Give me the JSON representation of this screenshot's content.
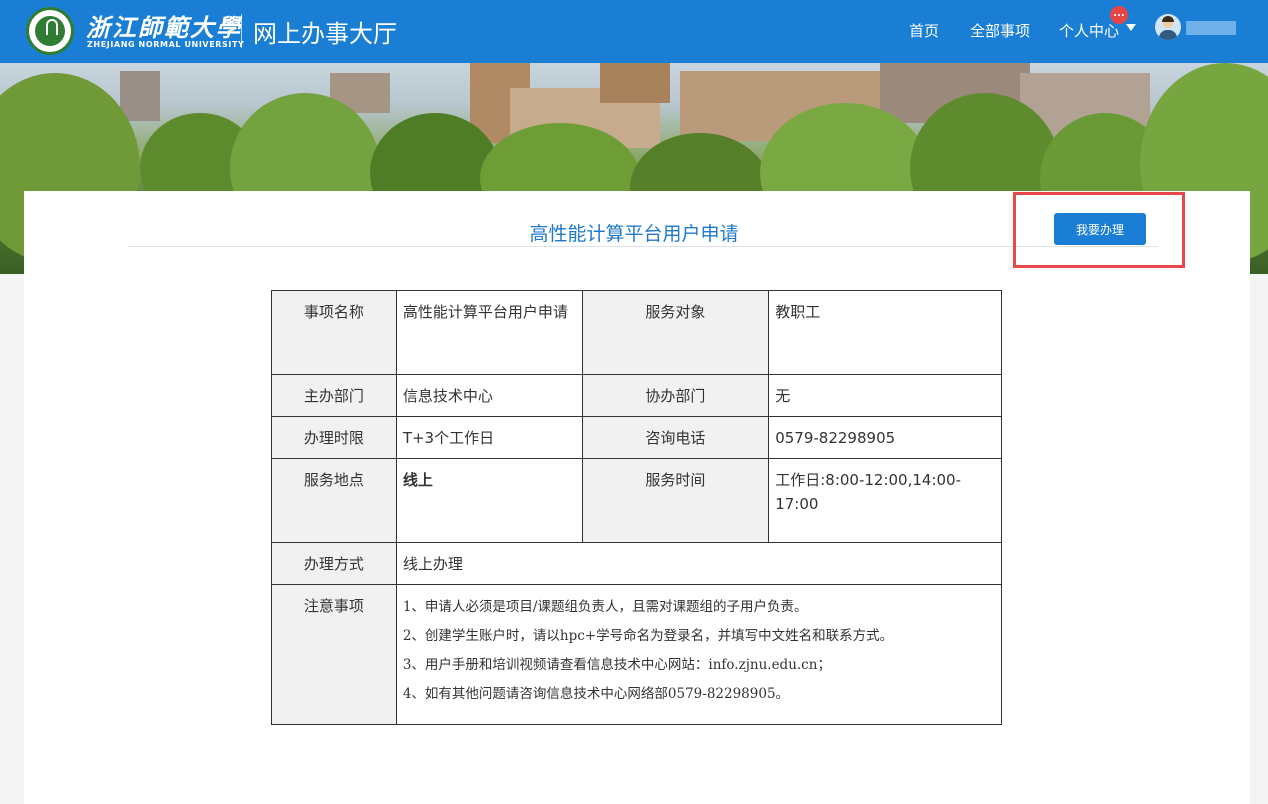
{
  "header": {
    "logo_text_cn": "浙江師範大學",
    "logo_text_en": "ZHEJIANG NORMAL UNIVERSITY",
    "site_title": "网上办事大厅",
    "nav": {
      "home": "首页",
      "all_items": "全部事项",
      "personal_center": "个人中心"
    },
    "notification_badge": "...",
    "brand_color": "#1a7fd4"
  },
  "page": {
    "title": "高性能计算平台用户申请",
    "apply_button": "我要办理",
    "accent_color": "#1f78c8",
    "highlight_color": "#e8474c"
  },
  "details": {
    "rows": [
      {
        "k1": "事项名称",
        "v1": "高性能计算平台用户申请",
        "k2": "服务对象",
        "v2": "教职工"
      },
      {
        "k1": "主办部门",
        "v1": "信息技术中心",
        "k2": "协办部门",
        "v2": "无"
      },
      {
        "k1": "办理时限",
        "v1": "T+3个工作日",
        "k2": "咨询电话",
        "v2": "0579-82298905"
      },
      {
        "k1": "服务地点",
        "v1": "线上",
        "k2": "服务时间",
        "v2": "工作日:8:00-12:00,14:00-17:00"
      }
    ],
    "method": {
      "k": "办理方式",
      "v": "线上办理"
    },
    "notes": {
      "k": "注意事项",
      "items": [
        "1、申请人必须是项目/课题组负责人，且需对课题组的子用户负责。",
        "2、创建学生账户时，请以hpc+学号命名为登录名，并填写中文姓名和联系方式。",
        "3、用户手册和培训视频请查看信息技术中心网站：info.zjnu.edu.cn；",
        "4、如有其他问题请咨询信息技术中心网络部0579-82298905。"
      ]
    }
  }
}
